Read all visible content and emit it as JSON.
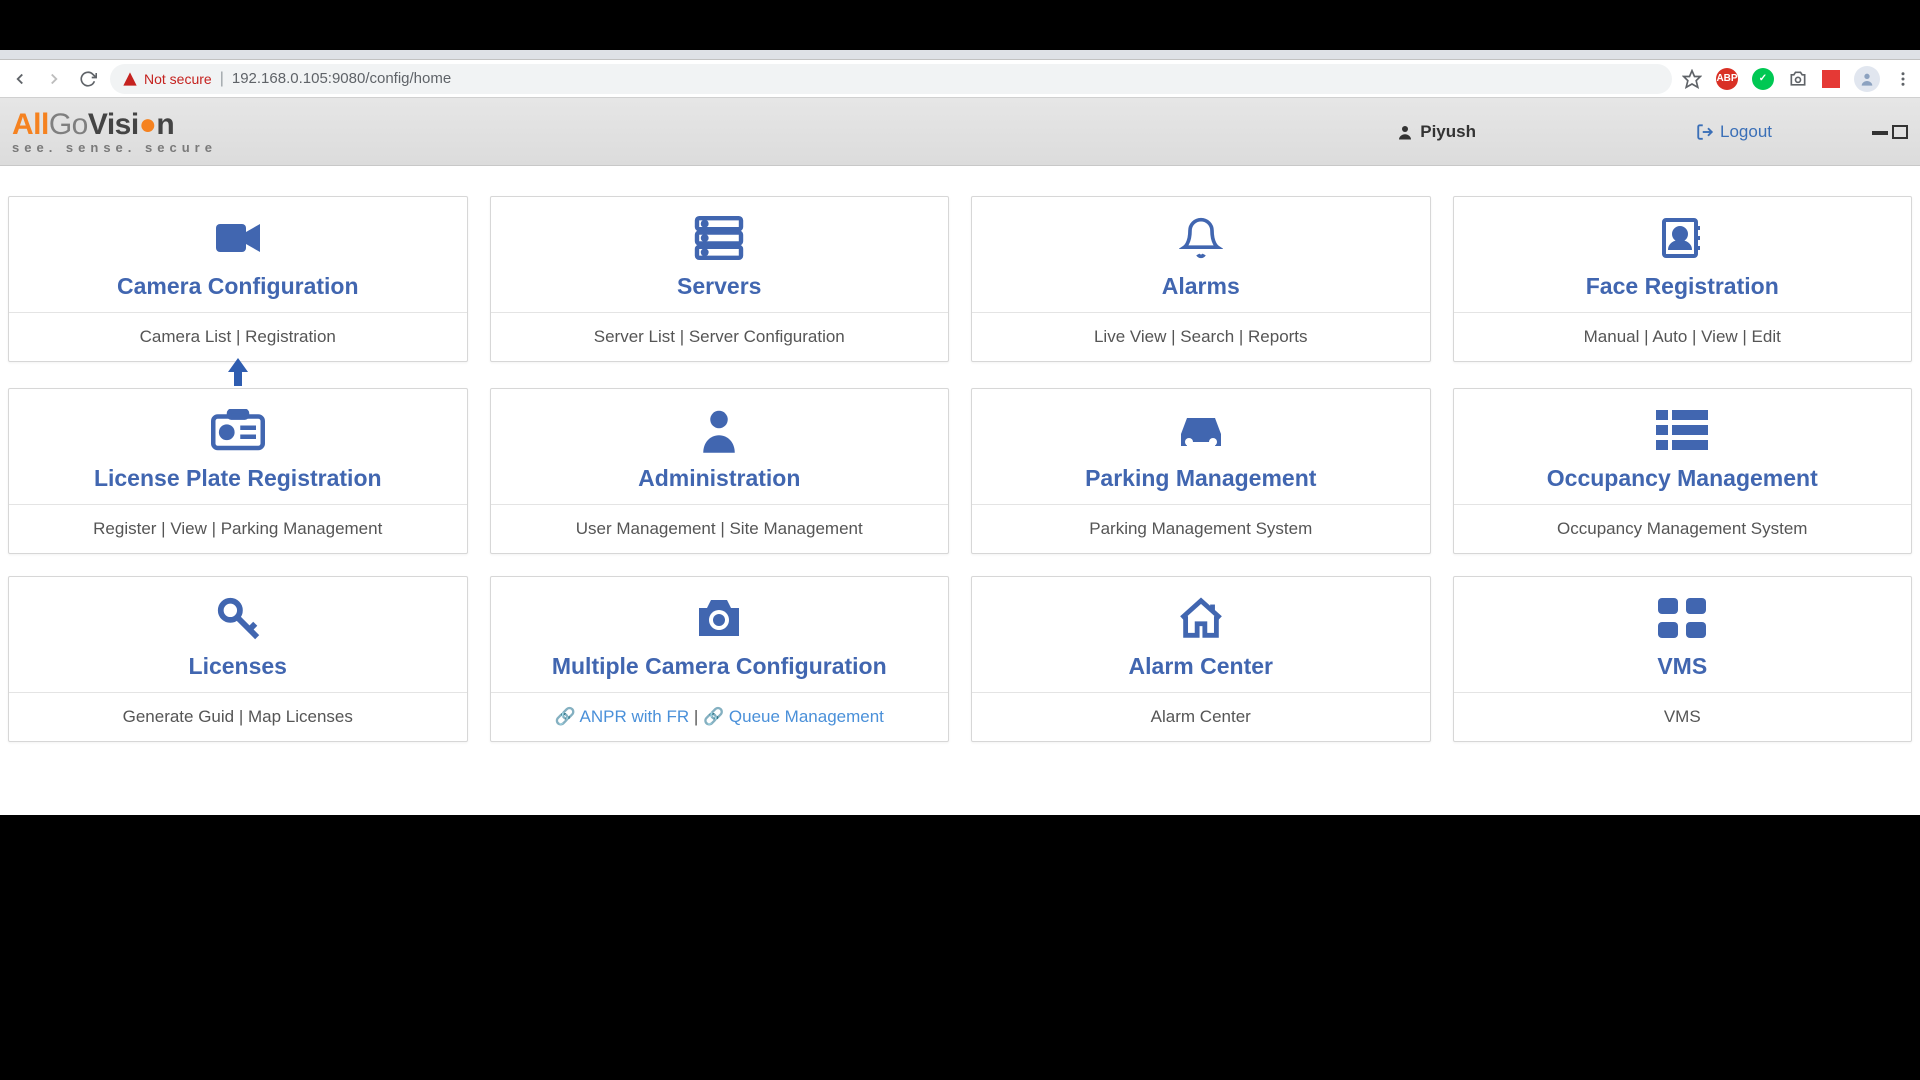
{
  "browser": {
    "not_secure": "Not secure",
    "url": "192.168.0.105:9080/config/home"
  },
  "header": {
    "logo_tag": "see. sense. secure",
    "user_name": "Piyush",
    "logout": "Logout"
  },
  "cards": [
    {
      "title": "Camera Configuration",
      "subtitle": "Camera List | Registration"
    },
    {
      "title": "Servers",
      "subtitle": "Server List | Server Configuration"
    },
    {
      "title": "Alarms",
      "subtitle": "Live View | Search | Reports"
    },
    {
      "title": "Face Registration",
      "subtitle": "Manual | Auto | View | Edit"
    },
    {
      "title": "License Plate Registration",
      "subtitle": "Register | View | Parking Management"
    },
    {
      "title": "Administration",
      "subtitle": "User Management | Site Management"
    },
    {
      "title": "Parking Management",
      "subtitle": "Parking Management System"
    },
    {
      "title": "Occupancy Management",
      "subtitle": "Occupancy Management System"
    },
    {
      "title": "Licenses",
      "subtitle": "Generate Guid | Map Licenses"
    },
    {
      "title": "Multiple Camera Configuration",
      "sub_link1": "ANPR with FR",
      "sub_sep": " | ",
      "sub_link2": "Queue Management"
    },
    {
      "title": "Alarm Center",
      "subtitle": "Alarm Center"
    },
    {
      "title": "VMS",
      "subtitle": "VMS"
    }
  ]
}
